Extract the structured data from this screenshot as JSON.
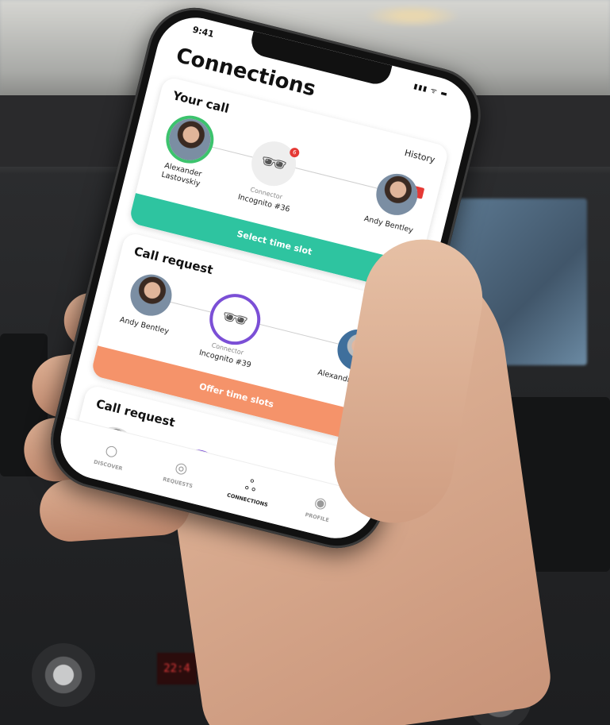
{
  "status_bar": {
    "time": "9:41",
    "icons": "▮▮▮ ᯤ ▬"
  },
  "screen": {
    "title": "Connections",
    "cards": [
      {
        "title": "Your call",
        "link": "History",
        "badge": "new",
        "left_person": "Alexander Lastovskiy",
        "connector_label": "Connector",
        "connector_name": "Incognito #36",
        "notification_count": "6",
        "right_person": "Andy Bentley",
        "action": "Select time slot"
      },
      {
        "title": "Call request",
        "left_person": "Andy Bentley",
        "connector_label": "Connector",
        "connector_name": "Incognito #39",
        "right_person": "Alexandre Santos",
        "action": "Offer time slots"
      },
      {
        "title": "Call request"
      }
    ],
    "tabs": [
      {
        "label": "DISCOVER",
        "icon": "search-icon"
      },
      {
        "label": "REQUESTS",
        "icon": "requests-icon"
      },
      {
        "label": "CONNECTIONS",
        "icon": "connections-icon",
        "active": true
      },
      {
        "label": "PROFILE",
        "icon": "profile-icon"
      }
    ]
  },
  "colors": {
    "teal": "#2ec4a0",
    "orange": "#f5936a",
    "purple_ring": "#7b4fd6",
    "green_ring": "#3cc36d",
    "badge_red": "#e53935"
  },
  "background": {
    "red_display": "22:4"
  }
}
